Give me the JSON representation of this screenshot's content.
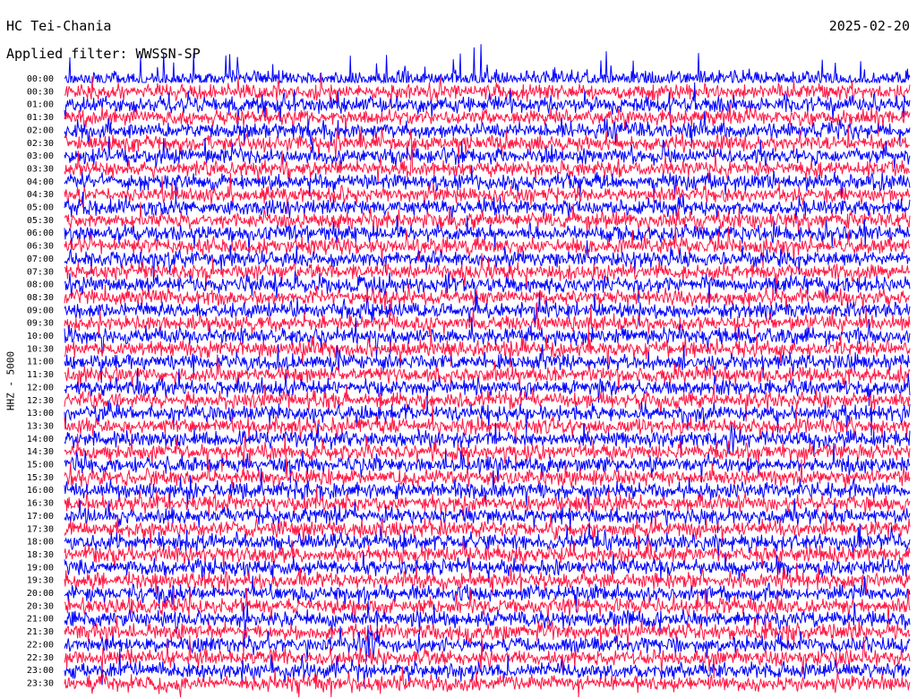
{
  "header": {
    "station": "HC Tei-Chania",
    "date": "2025-02-20",
    "filter": "Applied filter: WWSSN-SP"
  },
  "chart_data": {
    "type": "line",
    "channel_label": "HHZ - 5000",
    "row_labels": [
      "00:00",
      "00:30",
      "01:00",
      "01:30",
      "02:00",
      "02:30",
      "03:00",
      "03:30",
      "04:00",
      "04:30",
      "05:00",
      "05:30",
      "06:00",
      "06:30",
      "07:00",
      "07:30",
      "08:00",
      "08:30",
      "09:00",
      "09:30",
      "10:00",
      "10:30",
      "11:00",
      "11:30",
      "12:00",
      "12:30",
      "13:00",
      "13:30",
      "14:00",
      "14:30",
      "15:00",
      "15:30",
      "16:00",
      "16:30",
      "17:00",
      "17:30",
      "18:00",
      "18:30",
      "19:00",
      "19:30",
      "20:00",
      "20:30",
      "21:00",
      "21:30",
      "22:00",
      "22:30",
      "23:00",
      "23:30"
    ],
    "trace_colors": [
      "#0000ff",
      "#ff1744"
    ],
    "event_row_label": "22:00"
  }
}
